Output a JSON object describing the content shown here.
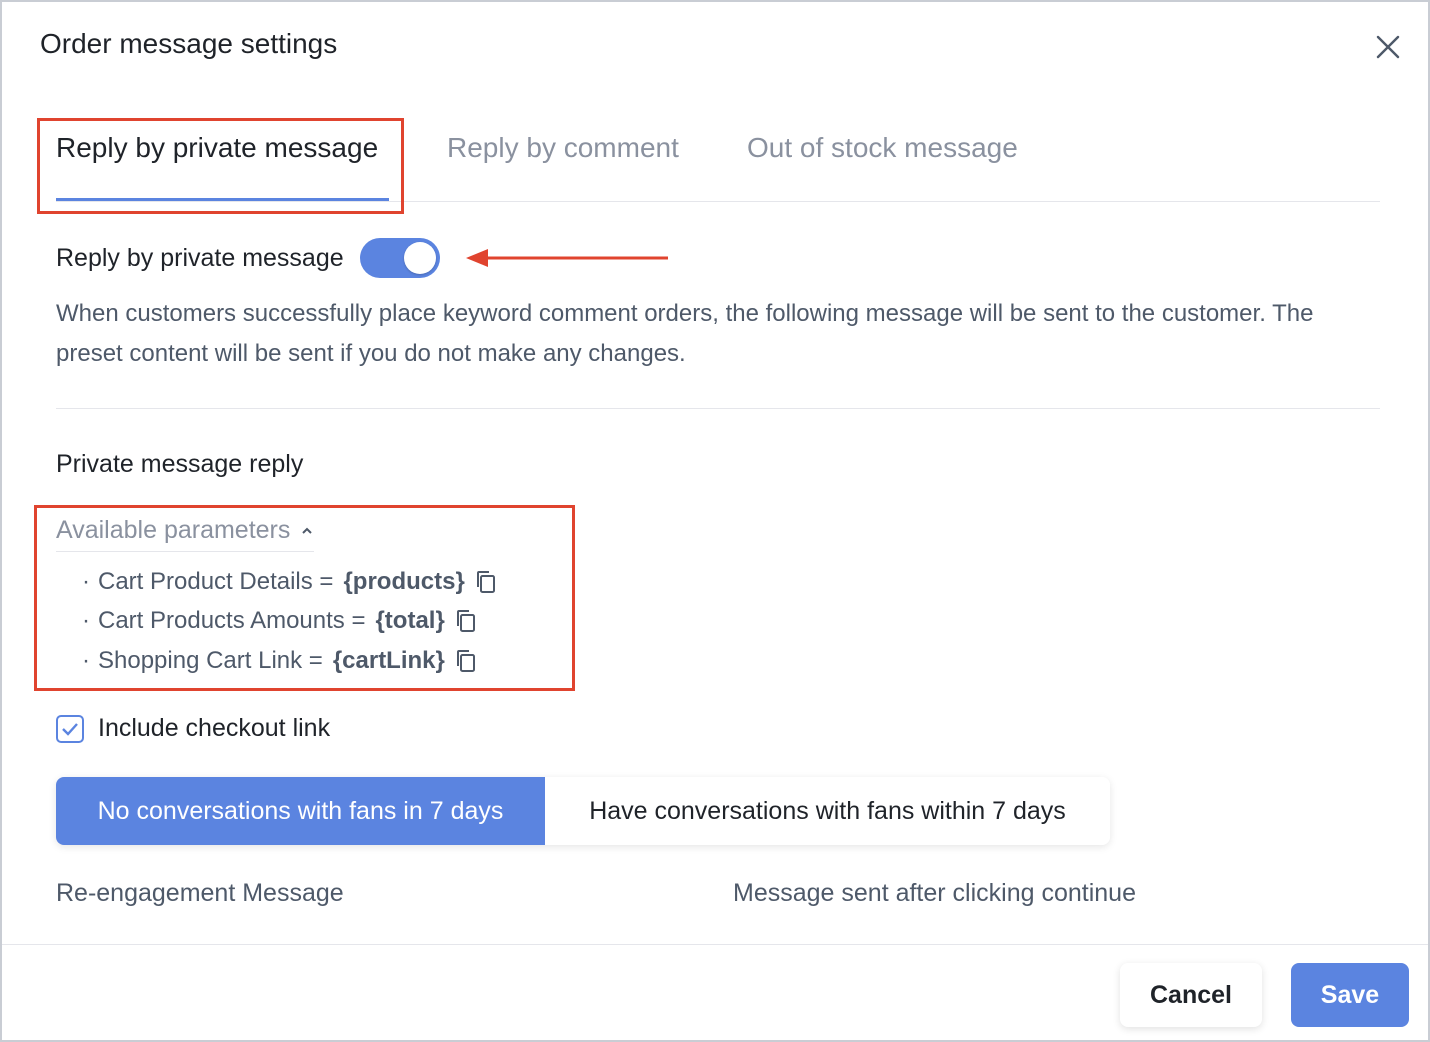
{
  "dialog": {
    "title": "Order message settings",
    "close_icon": "close-icon"
  },
  "tabs": [
    {
      "label": "Reply by private message",
      "active": true
    },
    {
      "label": "Reply by comment",
      "active": false
    },
    {
      "label": "Out of stock message",
      "active": false
    }
  ],
  "private_reply": {
    "toggle_label": "Reply by private message",
    "toggle_on": true,
    "description": "When customers successfully place keyword comment orders, the following message will be sent to the customer. The preset content will be sent if you do not make any changes."
  },
  "section": {
    "title": "Private message reply",
    "params_header": "Available parameters",
    "params": [
      {
        "label": "Cart Product Details =",
        "code": "{products}"
      },
      {
        "label": "Cart Products Amounts =",
        "code": "{total}"
      },
      {
        "label": "Shopping Cart Link =",
        "code": "{cartLink}"
      }
    ],
    "bullet": "·",
    "include_checkout_label": "Include checkout link",
    "include_checkout_checked": true
  },
  "segment": {
    "option_1": "No conversations with fans in 7 days",
    "option_2": "Have conversations with fans within 7 days",
    "selected": "option_1"
  },
  "columns": {
    "left": "Re-engagement Message",
    "right": "Message sent after clicking continue"
  },
  "footer": {
    "cancel_label": "Cancel",
    "save_label": "Save"
  },
  "colors": {
    "accent": "#5b84e0",
    "highlight": "#e0442f"
  }
}
